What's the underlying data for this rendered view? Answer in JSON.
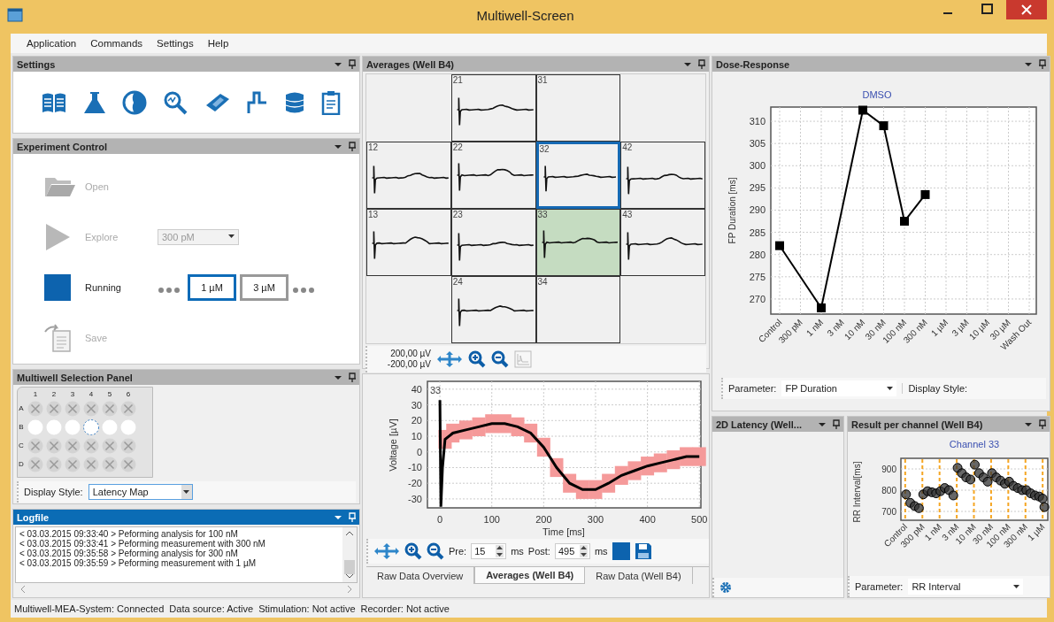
{
  "window": {
    "title": "Multiwell-Screen"
  },
  "menu": [
    "Application",
    "Commands",
    "Settings",
    "Help"
  ],
  "settings_panel": {
    "title": "Settings",
    "active": false
  },
  "experiment_panel": {
    "title": "Experiment Control",
    "active": false,
    "rows": [
      {
        "kind": "open",
        "label": "Open",
        "disabled": true
      },
      {
        "kind": "explore",
        "label": "Explore",
        "disabled": true,
        "dropdown": "300 pM"
      },
      {
        "kind": "running",
        "label": "Running",
        "disabled": false,
        "doses": [
          {
            "label": "1 µM",
            "selected": true
          },
          {
            "label": "3 µM",
            "selected": false
          }
        ]
      },
      {
        "kind": "save",
        "label": "Save",
        "disabled": true
      }
    ]
  },
  "multiwell_panel": {
    "title": "Multiwell Selection Panel",
    "active": false,
    "columns": [
      "1",
      "2",
      "3",
      "4",
      "5",
      "6"
    ],
    "rows": [
      {
        "label": "A",
        "wells": [
          {
            "disabled": true,
            "selected": false
          },
          {
            "disabled": true,
            "selected": false
          },
          {
            "disabled": true,
            "selected": false
          },
          {
            "disabled": true,
            "selected": false
          },
          {
            "disabled": true,
            "selected": false
          },
          {
            "disabled": true,
            "selected": false
          }
        ]
      },
      {
        "label": "B",
        "wells": [
          {
            "disabled": false,
            "selected": false
          },
          {
            "disabled": false,
            "selected": false
          },
          {
            "disabled": false,
            "selected": false
          },
          {
            "disabled": false,
            "selected": true
          },
          {
            "disabled": false,
            "selected": false
          },
          {
            "disabled": false,
            "selected": false
          }
        ]
      },
      {
        "label": "C",
        "wells": [
          {
            "disabled": true,
            "selected": false
          },
          {
            "disabled": true,
            "selected": false
          },
          {
            "disabled": true,
            "selected": false
          },
          {
            "disabled": true,
            "selected": false
          },
          {
            "disabled": true,
            "selected": false
          },
          {
            "disabled": true,
            "selected": false
          }
        ]
      },
      {
        "label": "D",
        "wells": [
          {
            "disabled": true,
            "selected": false
          },
          {
            "disabled": true,
            "selected": false
          },
          {
            "disabled": true,
            "selected": false
          },
          {
            "disabled": true,
            "selected": false
          },
          {
            "disabled": true,
            "selected": false
          },
          {
            "disabled": true,
            "selected": false
          }
        ]
      }
    ],
    "display_style_label": "Display Style:",
    "display_style": "Latency Map"
  },
  "logfile_panel": {
    "title": "Logfile",
    "active": true,
    "lines": [
      "< 03.03.2015 09:33:40 >  Peforming analysis for 100 nM",
      "< 03.03.2015 09:33:41 >  Peforming measurement with 300 nM",
      "< 03.03.2015 09:35:58 >  Peforming analysis for 300 nM",
      "< 03.03.2015 09:35:59 >  Peforming measurement with 1 µM"
    ]
  },
  "averages_panel": {
    "title": "Averages (Well B4)",
    "active": false,
    "cells": [
      {
        "kind": "empty"
      },
      {
        "kind": "channel",
        "label": "21",
        "trace": true,
        "selected": false,
        "highlighted": false
      },
      {
        "kind": "channel",
        "label": "31",
        "trace": false,
        "selected": false,
        "highlighted": false
      },
      {
        "kind": "empty"
      },
      {
        "kind": "channel",
        "label": "12",
        "trace": true,
        "selected": false,
        "highlighted": false
      },
      {
        "kind": "channel",
        "label": "22",
        "trace": true,
        "selected": false,
        "highlighted": false
      },
      {
        "kind": "channel",
        "label": "32",
        "trace": true,
        "selected": true,
        "highlighted": false
      },
      {
        "kind": "channel",
        "label": "42",
        "trace": true,
        "selected": false,
        "highlighted": false
      },
      {
        "kind": "channel",
        "label": "13",
        "trace": true,
        "selected": false,
        "highlighted": false
      },
      {
        "kind": "channel",
        "label": "23",
        "trace": true,
        "selected": false,
        "highlighted": false
      },
      {
        "kind": "channel",
        "label": "33",
        "trace": true,
        "selected": false,
        "highlighted": true
      },
      {
        "kind": "channel",
        "label": "43",
        "trace": true,
        "selected": false,
        "highlighted": false
      },
      {
        "kind": "empty"
      },
      {
        "kind": "channel",
        "label": "24",
        "trace": true,
        "selected": false,
        "highlighted": false
      },
      {
        "kind": "channel",
        "label": "34",
        "trace": false,
        "selected": false,
        "highlighted": false
      },
      {
        "kind": "empty"
      }
    ],
    "scale_max": "200,00 µV",
    "scale_min": "-200,00 µV"
  },
  "trace_view": {
    "chart_data": {
      "type": "line",
      "title": "33",
      "xlabel": "Time [ms]",
      "ylabel": "Voltage [µV]",
      "x": [
        0,
        2,
        5,
        10,
        25,
        50,
        75,
        100,
        125,
        150,
        175,
        200,
        225,
        250,
        275,
        300,
        325,
        350,
        375,
        400,
        425,
        450,
        475,
        500
      ],
      "series": [
        {
          "color": "#000000",
          "values": [
            33,
            -35,
            -10,
            8,
            12,
            14,
            16,
            18,
            18,
            16,
            12,
            3,
            -10,
            -20,
            -24,
            -24,
            -20,
            -15,
            -12,
            -9,
            -7,
            -5,
            -3,
            -3
          ],
          "errors": [
            null,
            null,
            null,
            6,
            6,
            6,
            6,
            6,
            6,
            6,
            6,
            6,
            6,
            6,
            6,
            6,
            6,
            6,
            6,
            6,
            6,
            6,
            6,
            6
          ]
        }
      ],
      "grid": true,
      "xlim": [
        -24,
        503
      ],
      "ylim": [
        -35.7,
        45
      ],
      "xticks": [
        0,
        100,
        200,
        300,
        400,
        500
      ],
      "yticks": [
        -30,
        -20,
        -10,
        0,
        10,
        20,
        30,
        40
      ]
    },
    "pre_label": "Pre:",
    "pre": "15",
    "pre_unit": "ms",
    "post_label": "Post:",
    "post": "495",
    "post_unit": "ms",
    "tabs": [
      {
        "label": "Raw Data Overview",
        "selected": false
      },
      {
        "label": "Averages (Well B4)",
        "selected": true
      },
      {
        "label": "Raw Data (Well B4)",
        "selected": false
      }
    ]
  },
  "dose_response_panel": {
    "title": "Dose-Response",
    "active": false,
    "chart_data": {
      "type": "line",
      "title": "DMSO",
      "ylabel": "FP Duration [ms]",
      "categories": [
        "Control",
        "300 pM",
        "1 nM",
        "3 nM",
        "10 nM",
        "30 nM",
        "100 nM",
        "300 nM",
        "1 µM",
        "3 µM",
        "10 µM",
        "30 µM",
        "Wash Out"
      ],
      "series": [
        {
          "color": "#000000",
          "marker": "square",
          "values": [
            282,
            null,
            268,
            null,
            312.5,
            309,
            287.5,
            293.5,
            null,
            null,
            null,
            null,
            null
          ]
        }
      ],
      "grid": true,
      "ylim": [
        266.6,
        313.2
      ],
      "yticks": [
        270,
        275,
        280,
        285,
        290,
        295,
        300,
        305,
        310
      ]
    },
    "parameter_label": "Parameter:",
    "parameter": "FP Duration",
    "display_style_label": "Display Style:"
  },
  "latency_panel": {
    "title": "2D Latency (Well...",
    "active": false
  },
  "result_panel": {
    "title": "Result per channel (Well B4)",
    "active": false,
    "plot": {
      "title": "Channel 33",
      "ylabel": "RR Interval[ms]",
      "y_labels": [
        "900",
        "800",
        "700"
      ],
      "x_labels": [
        "Control",
        "300 pM",
        "1 nM",
        "3 nM",
        "10 nM",
        "30 nM",
        "100 nM",
        "300 nM",
        "1 µM"
      ]
    },
    "parameter_label": "Parameter:",
    "parameter": "RR Interval"
  },
  "status_bar": [
    "Multiwell-MEA-System: Connected",
    "Data source: Active",
    "Stimulation: Not active",
    "Recorder: Not active"
  ]
}
